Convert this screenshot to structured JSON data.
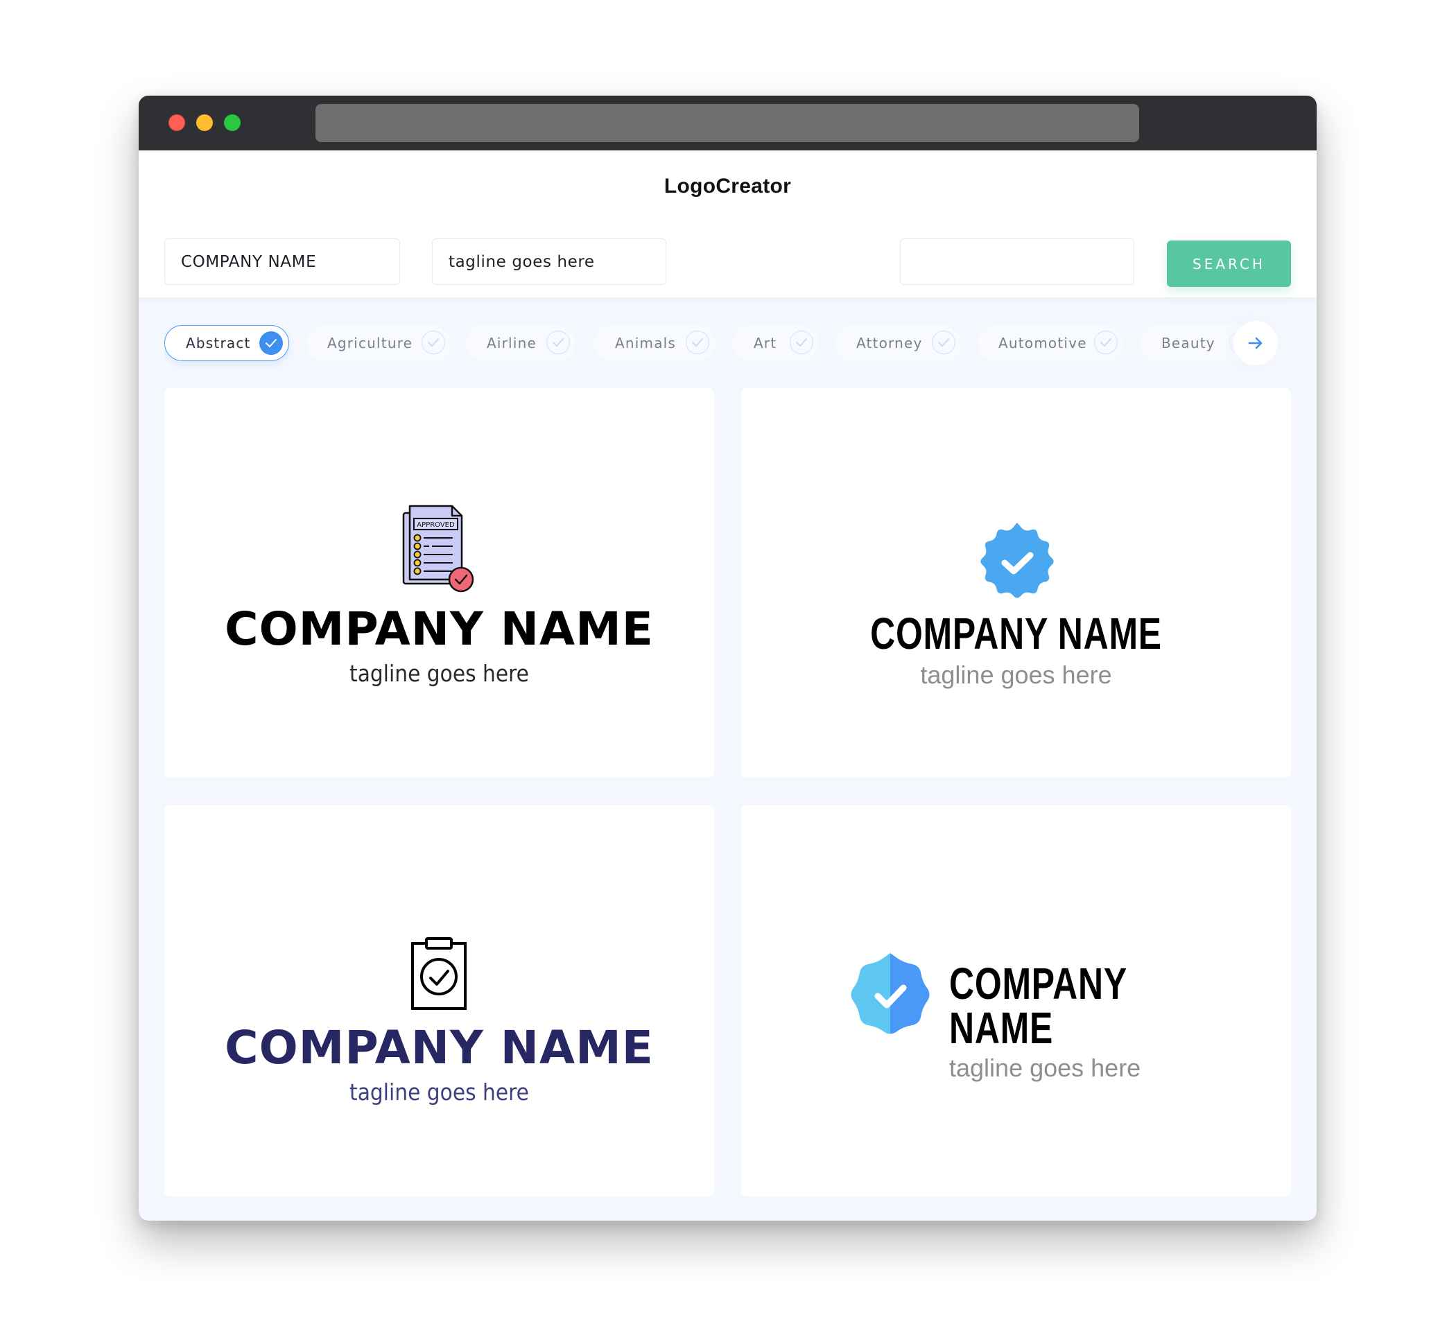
{
  "browser": {
    "traffic_lights": [
      "close",
      "minimize",
      "maximize"
    ],
    "url": ""
  },
  "header": {
    "title": "LogoCreator"
  },
  "search": {
    "company_name_value": "COMPANY NAME",
    "tagline_value": "tagline goes here",
    "keyword_value": "",
    "button_label": "SEARCH"
  },
  "categories": {
    "items": [
      {
        "label": "Abstract",
        "selected": true
      },
      {
        "label": "Agriculture",
        "selected": false
      },
      {
        "label": "Airline",
        "selected": false
      },
      {
        "label": "Animals",
        "selected": false
      },
      {
        "label": "Art",
        "selected": false
      },
      {
        "label": "Attorney",
        "selected": false
      },
      {
        "label": "Automotive",
        "selected": false
      },
      {
        "label": "Beauty",
        "selected": false
      }
    ],
    "next_icon": "arrow-right-icon"
  },
  "logos": [
    {
      "icon": "approved-document-icon",
      "company": "COMPANY NAME",
      "tagline": "tagline goes here",
      "name_color": "#000000",
      "tagline_color": "#2a2a2a"
    },
    {
      "icon": "verified-badge-icon",
      "company": "COMPANY NAME",
      "tagline": "tagline goes here",
      "name_color": "#000000",
      "tagline_color": "#8e8e8e",
      "icon_color": "#4aa8f0"
    },
    {
      "icon": "clipboard-check-icon",
      "company": "COMPANY NAME",
      "tagline": "tagline goes here",
      "name_color": "#272863",
      "tagline_color": "#3d3f7e"
    },
    {
      "icon": "verified-badge-split-icon",
      "company": "COMPANY NAME",
      "tagline": "tagline goes here",
      "name_color": "#000000",
      "tagline_color": "#8e8e8e",
      "icon_colors": [
        "#5ec8f2",
        "#4a98f7"
      ]
    }
  ],
  "colors": {
    "accent_green": "#58c79f",
    "accent_blue": "#3d8ff0",
    "titlebar": "#2f3033",
    "page_bg": "#f4f7fd"
  }
}
